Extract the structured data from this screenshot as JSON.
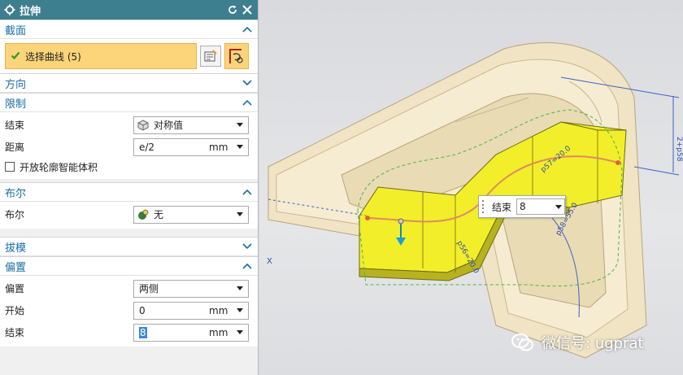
{
  "dialog": {
    "title": "拉伸",
    "icons": [
      "gear-icon",
      "reset-icon",
      "close-icon"
    ]
  },
  "section_profile": {
    "title": "截面",
    "select_label": "选择曲线 (5)"
  },
  "section_direction": {
    "title": "方向"
  },
  "section_limits": {
    "title": "限制",
    "end_label": "结束",
    "end_value": "对称值",
    "distance_label": "距离",
    "distance_value": "e/2",
    "distance_unit": "mm",
    "open_profile_label": "开放轮廓智能体积"
  },
  "section_boolean": {
    "title": "布尔",
    "boolean_label": "布尔",
    "boolean_value": "无"
  },
  "section_draft": {
    "title": "拔模"
  },
  "section_offset": {
    "title": "偏置",
    "offset_label": "偏置",
    "offset_value": "两侧",
    "start_label": "开始",
    "start_value": "0",
    "start_unit": "mm",
    "end_label": "结束",
    "end_value": "8",
    "end_unit": "mm"
  },
  "viewport": {
    "float_end_label": "结束",
    "float_end_value": "8",
    "axis_x": "X",
    "dim_p56": "p56=20.0",
    "dim_p57": "p57=20.0",
    "dim_p58": "p58=55.0",
    "dim_side": "2+p58"
  },
  "watermark": {
    "text": "微信号: ugprat"
  },
  "colors": {
    "titlebar": "#3e7f8f",
    "section_text": "#1a6ea6",
    "selection_highlight": "#fcd47a",
    "solid_yellow": "#f2ee2a"
  }
}
